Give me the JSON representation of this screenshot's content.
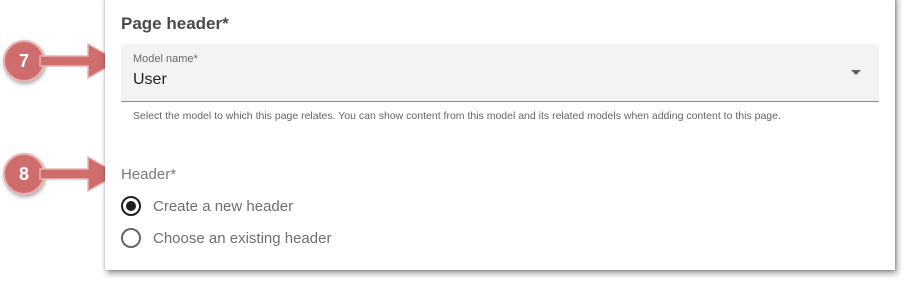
{
  "panel": {
    "title": "Page header*",
    "model_select": {
      "label": "Model name*",
      "value": "User",
      "icon": "chevron-down-icon",
      "helper": "Select the model to which this page relates. You can show content from this model and its related models when adding content to this page."
    },
    "header_group": {
      "label": "Header*",
      "options": [
        {
          "label": "Create a new header",
          "selected": true
        },
        {
          "label": "Choose an existing header",
          "selected": false
        }
      ]
    }
  },
  "callouts": [
    {
      "number": "7",
      "color": "#cf6d6d"
    },
    {
      "number": "8",
      "color": "#cf6d6d"
    }
  ]
}
